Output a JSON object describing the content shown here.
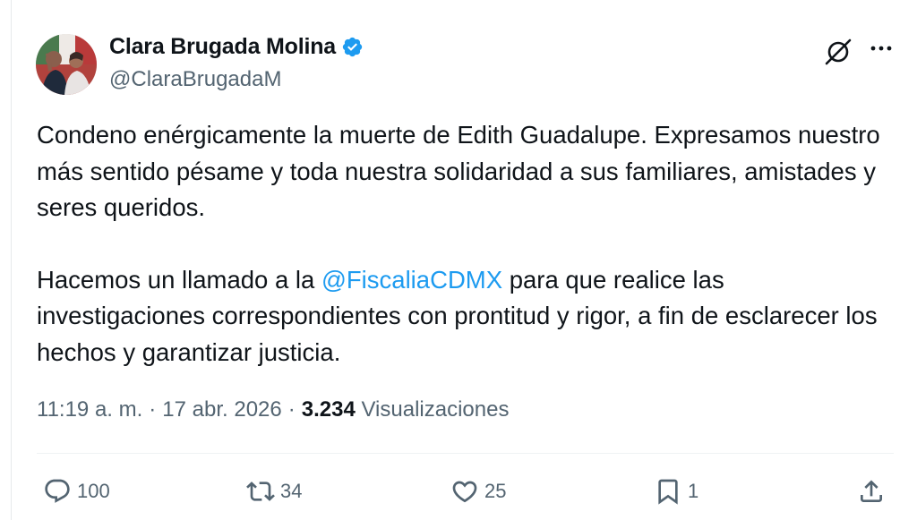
{
  "author": {
    "name": "Clara Brugada Molina",
    "handle": "@ClaraBrugadaM",
    "verified": true
  },
  "tweet": {
    "paragraph1": "Condeno enérgicamente la muerte de Edith Guadalupe. Expresamos nuestro más sentido pésame y toda nuestra solidaridad a sus familiares, amistades y seres queridos.",
    "paragraph2_before": "Hacemos un llamado a la ",
    "mention": "@FiscaliaCDMX",
    "paragraph2_after": " para que realice las investigaciones correspondientes con prontitud y rigor, a fin de esclarecer los hechos y garantizar justicia."
  },
  "meta": {
    "time": "11:19 a. m.",
    "separator": "·",
    "date": "17 abr. 2026",
    "views_count": "3.234",
    "views_label": "Visualizaciones"
  },
  "actions": {
    "replies": "100",
    "reposts": "34",
    "likes": "25",
    "bookmarks": "1"
  },
  "icons": {
    "verified": "verified-badge-icon",
    "grok": "grok-icon",
    "more": "more-icon",
    "reply": "reply-icon",
    "repost": "repost-icon",
    "like": "heart-icon",
    "bookmark": "bookmark-icon",
    "share": "share-icon"
  },
  "colors": {
    "accent": "#1d9bf0",
    "text": "#0f1419",
    "secondary": "#536471"
  }
}
